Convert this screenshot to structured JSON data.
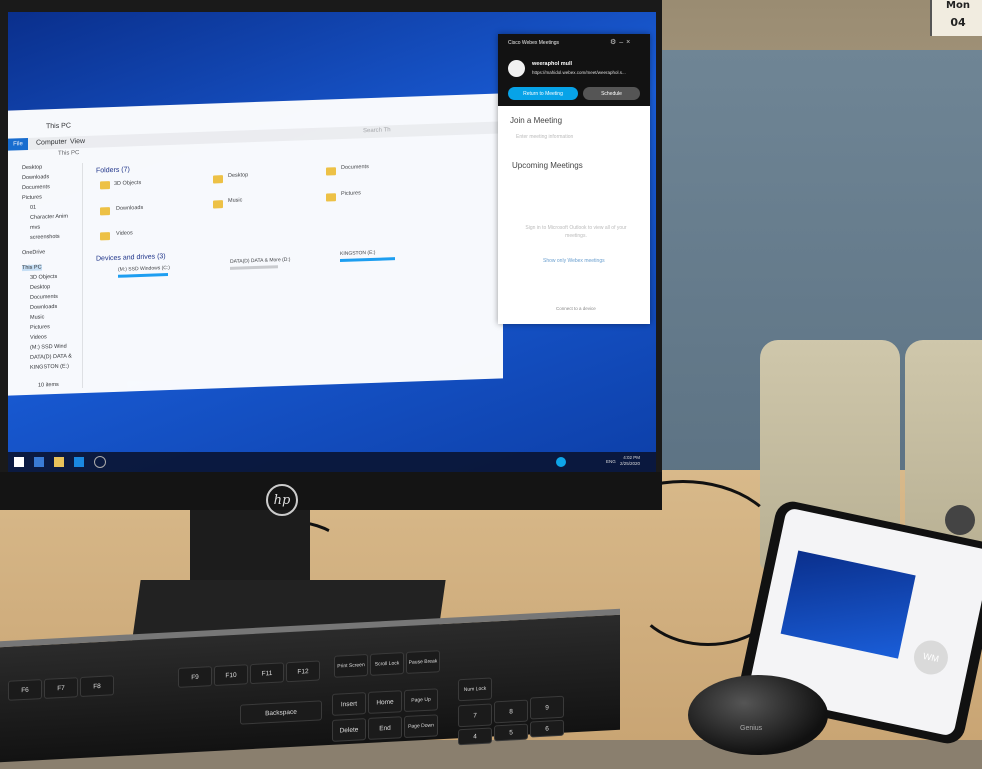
{
  "calendar": {
    "month": "Mon",
    "day": "04"
  },
  "monitor": {
    "brand": "hp"
  },
  "explorer": {
    "title": "This PC",
    "tabs": [
      "File",
      "Computer",
      "View"
    ],
    "breadcrumb": "This PC",
    "search_placeholder": "Search Th",
    "nav_items": [
      "Desktop",
      "Downloads",
      "Documents",
      "Pictures",
      "01",
      "Character Anim",
      "mvs",
      "screenshots",
      "OneDrive",
      "This PC",
      "3D Objects",
      "Desktop",
      "Documents",
      "Downloads",
      "Music",
      "Pictures",
      "Videos",
      "(M:) SSD Wind",
      "DATA(D) DATA &",
      "KINGSTON (E:)"
    ],
    "folders_heading": "Folders (7)",
    "folders": [
      "3D Objects",
      "Desktop",
      "Documents",
      "Downloads",
      "Music",
      "Pictures",
      "Videos"
    ],
    "drives_heading": "Devices and drives (3)",
    "drives": [
      "(M:) SSD Windows (C:)",
      "DATA(D) DATA & More (D:)",
      "KINGSTON (E:)"
    ],
    "status": "10 items"
  },
  "webex": {
    "title": "Cisco Webex Meetings",
    "user_name": "weeraphol mull",
    "url": "https://mahidol.webex.com/meet/weeraphol.s...",
    "return_label": "Return to Meeting",
    "schedule_label": "Schedule",
    "join_heading": "Join a Meeting",
    "join_placeholder": "Enter meeting information",
    "upcoming_heading": "Upcoming Meetings",
    "signin_text": "Sign in to Microsoft Outlook to view all of your meetings.",
    "show_only": "Show only Webex meetings",
    "connect": "Connect to a device"
  },
  "taskbar": {
    "lang": "ENG",
    "time": "4:02 PM",
    "date": "2/25/2020"
  },
  "phone": {
    "avatar_initials": "WM"
  },
  "keyboard": {
    "keys": [
      "F6",
      "F7",
      "F8",
      "F9",
      "F10",
      "F11",
      "F12",
      "Print Screen",
      "Scroll Lock",
      "Pause Break",
      "Backspace",
      "Insert",
      "Home",
      "Page Up",
      "Num Lock",
      "Delete",
      "End",
      "Page Down",
      "7",
      "8",
      "9",
      "4",
      "5",
      "6"
    ]
  },
  "mouse": {
    "brand": "Genius"
  }
}
